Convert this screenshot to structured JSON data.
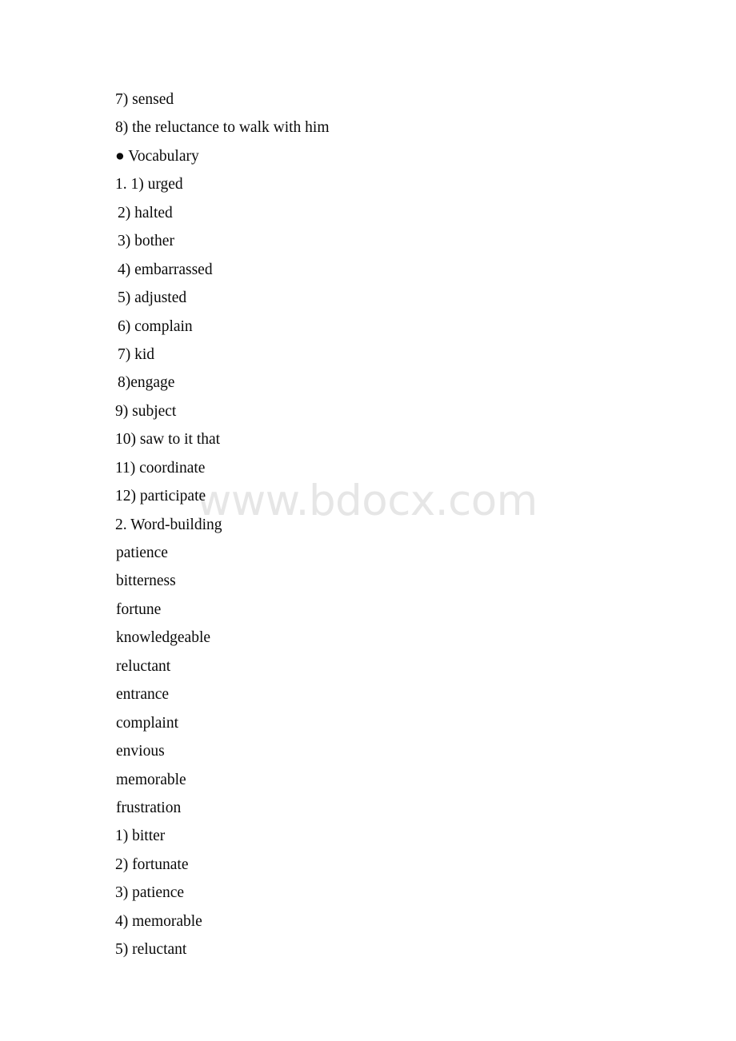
{
  "page": {
    "background_color": "#ffffff",
    "text_color": "#0a0a0a"
  },
  "watermark": {
    "text": "www.bdocx.com",
    "color": "#e6e6e6"
  },
  "document": {
    "bullet_glyph": "●",
    "lines": [
      {
        "id": "line-01",
        "text": "7) sensed",
        "indent": "base"
      },
      {
        "id": "line-02",
        "text": "8) the reluctance to walk with him",
        "indent": "base"
      },
      {
        "id": "line-03",
        "text": "● Vocabulary",
        "indent": "base",
        "kind": "bullet-heading"
      },
      {
        "id": "line-04",
        "text": "1. 1) urged",
        "indent": "base",
        "kind": "numbered-heading"
      },
      {
        "id": "line-05",
        "text": "2) halted",
        "indent": "sub"
      },
      {
        "id": "line-06",
        "text": "3) bother",
        "indent": "sub"
      },
      {
        "id": "line-07",
        "text": "4) embarrassed",
        "indent": "sub"
      },
      {
        "id": "line-08",
        "text": "5) adjusted",
        "indent": "sub"
      },
      {
        "id": "line-09",
        "text": "6) complain",
        "indent": "sub"
      },
      {
        "id": "line-10",
        "text": "7) kid",
        "indent": "sub"
      },
      {
        "id": "line-11",
        "text": "8)engage",
        "indent": "sub"
      },
      {
        "id": "line-12",
        "text": "9) subject",
        "indent": "base"
      },
      {
        "id": "line-13",
        "text": "10) saw to it that",
        "indent": "base"
      },
      {
        "id": "line-14",
        "text": "11) coordinate",
        "indent": "base"
      },
      {
        "id": "line-15",
        "text": "12) participate",
        "indent": "base"
      },
      {
        "id": "line-16",
        "text": "2. Word-building",
        "indent": "base",
        "kind": "numbered-heading"
      },
      {
        "id": "line-17",
        "text": "patience",
        "indent": "word"
      },
      {
        "id": "line-18",
        "text": "bitterness",
        "indent": "word"
      },
      {
        "id": "line-19",
        "text": "fortune",
        "indent": "word"
      },
      {
        "id": "line-20",
        "text": "knowledgeable",
        "indent": "word"
      },
      {
        "id": "line-21",
        "text": "reluctant",
        "indent": "word"
      },
      {
        "id": "line-22",
        "text": "entrance",
        "indent": "word"
      },
      {
        "id": "line-23",
        "text": "complaint",
        "indent": "word"
      },
      {
        "id": "line-24",
        "text": "envious",
        "indent": "word"
      },
      {
        "id": "line-25",
        "text": "memorable",
        "indent": "word"
      },
      {
        "id": "line-26",
        "text": "frustration",
        "indent": "word"
      },
      {
        "id": "line-27",
        "text": "1) bitter",
        "indent": "base"
      },
      {
        "id": "line-28",
        "text": "2) fortunate",
        "indent": "base"
      },
      {
        "id": "line-29",
        "text": "3) patience",
        "indent": "base"
      },
      {
        "id": "line-30",
        "text": "4) memorable",
        "indent": "base"
      },
      {
        "id": "line-31",
        "text": "5) reluctant",
        "indent": "base"
      }
    ]
  }
}
